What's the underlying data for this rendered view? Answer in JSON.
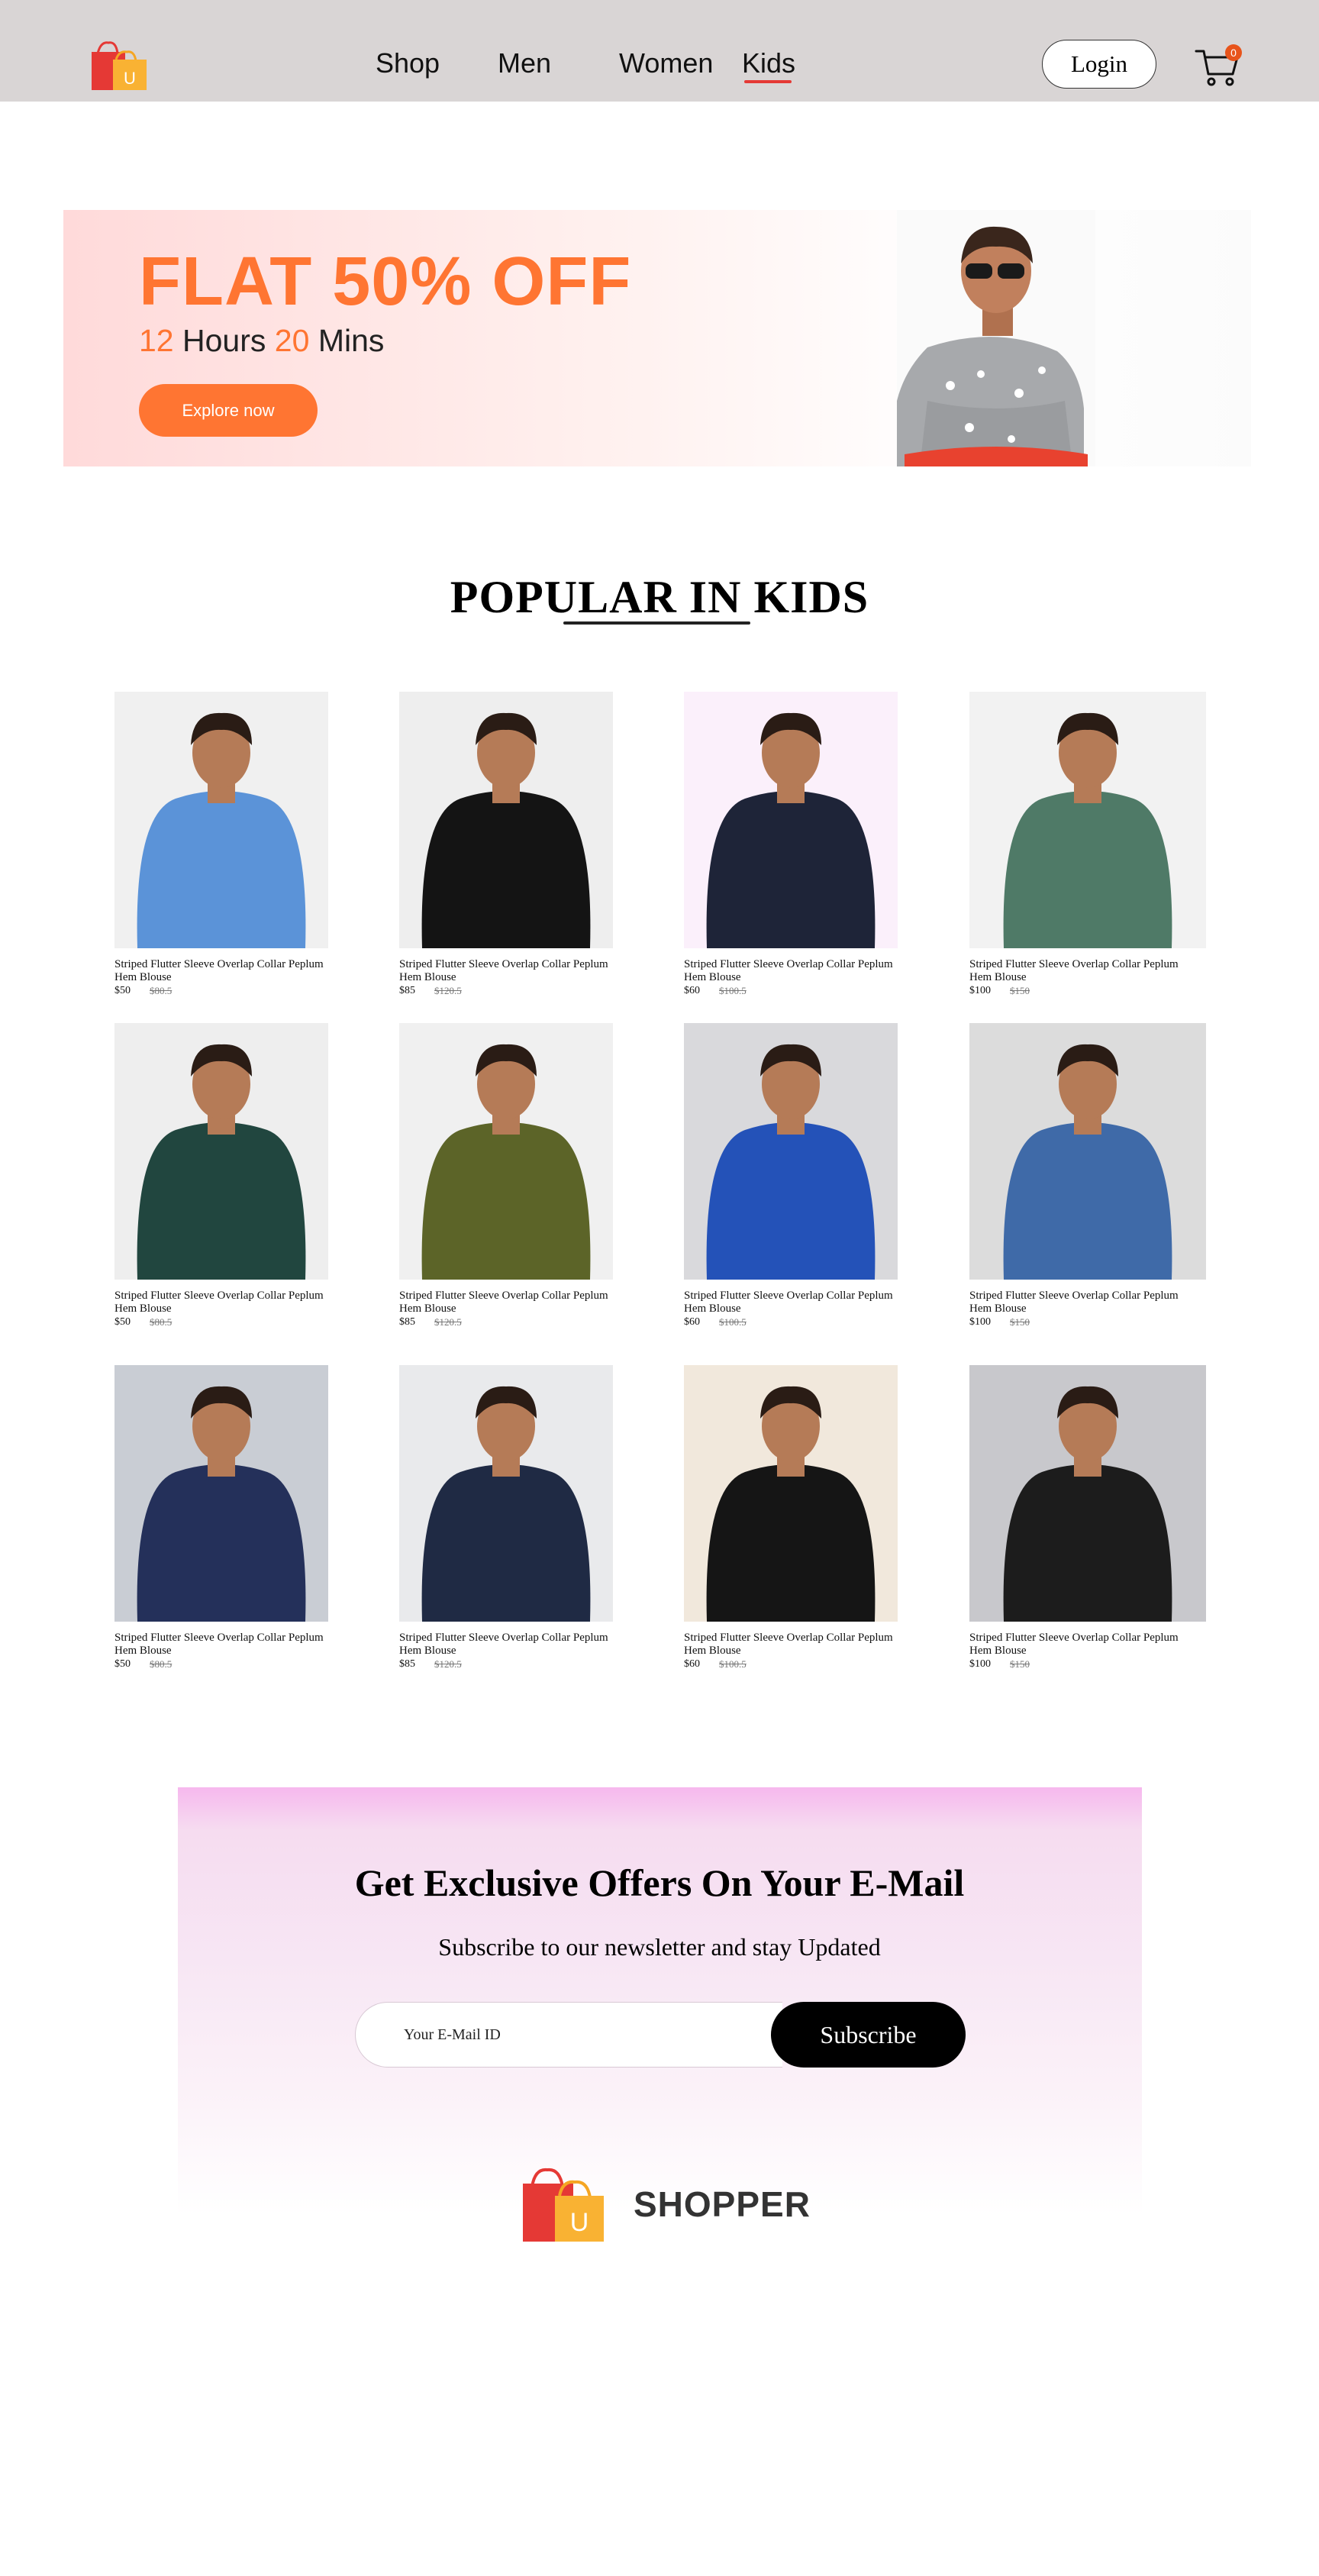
{
  "nav": {
    "links": [
      "Shop",
      "Men",
      "Women",
      "Kids"
    ],
    "active": "Kids",
    "login_label": "Login",
    "cart_count": "0",
    "logo_letter": "U"
  },
  "hero": {
    "title": "FLAT 50% OFF",
    "hours": "12",
    "hours_label": "Hours",
    "mins": "20",
    "mins_label": "Mins",
    "cta": "Explore now"
  },
  "popular": {
    "title": "POPULAR IN KIDS",
    "products": [
      {
        "name": "Striped Flutter Sleeve Overlap Collar Peplum Hem Blouse",
        "price": "$50",
        "old_price": "$80.5"
      },
      {
        "name": "Striped Flutter Sleeve Overlap Collar Peplum Hem Blouse",
        "price": "$85",
        "old_price": "$120.5"
      },
      {
        "name": "Striped Flutter Sleeve Overlap Collar Peplum Hem Blouse",
        "price": "$60",
        "old_price": "$100.5"
      },
      {
        "name": "Striped Flutter Sleeve Overlap Collar Peplum Hem Blouse",
        "price": "$100",
        "old_price": "$150"
      },
      {
        "name": "Striped Flutter Sleeve Overlap Collar Peplum Hem Blouse",
        "price": "$50",
        "old_price": "$80.5"
      },
      {
        "name": "Striped Flutter Sleeve Overlap Collar Peplum Hem Blouse",
        "price": "$85",
        "old_price": "$120.5"
      },
      {
        "name": "Striped Flutter Sleeve Overlap Collar Peplum Hem Blouse",
        "price": "$60",
        "old_price": "$100.5"
      },
      {
        "name": "Striped Flutter Sleeve Overlap Collar Peplum Hem Blouse",
        "price": "$100",
        "old_price": "$150"
      },
      {
        "name": "Striped Flutter Sleeve Overlap Collar Peplum Hem Blouse",
        "price": "$50",
        "old_price": "$80.5"
      },
      {
        "name": "Striped Flutter Sleeve Overlap Collar Peplum Hem Blouse",
        "price": "$85",
        "old_price": "$120.5"
      },
      {
        "name": "Striped Flutter Sleeve Overlap Collar Peplum Hem Blouse",
        "price": "$60",
        "old_price": "$100.5"
      },
      {
        "name": "Striped Flutter Sleeve Overlap Collar Peplum Hem Blouse",
        "price": "$100",
        "old_price": "$150"
      }
    ]
  },
  "newsletter": {
    "title": "Get Exclusive Offers On Your E-Mail",
    "subtitle": "Subscribe to our newsletter and stay Updated",
    "email_placeholder": "Your E-Mail ID",
    "button_label": "Subscribe"
  },
  "footer": {
    "brand": "SHOPPER",
    "logo_letter": "U"
  },
  "colors": {
    "accent": "#ff7532",
    "nav_bg": "#d9d5d5",
    "active_underline": "#e53935",
    "button_dark": "#000000"
  }
}
